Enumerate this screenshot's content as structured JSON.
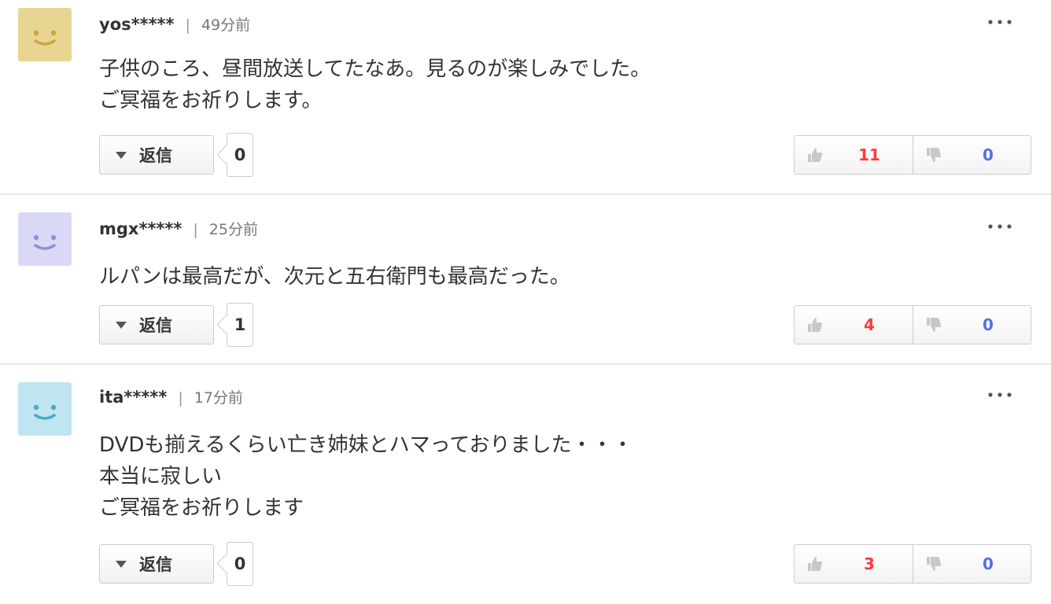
{
  "comments": [
    {
      "user": "yos*****",
      "divider": "|",
      "time": "49分前",
      "avatar_color": "#e8d592",
      "face_color": "#c9a640",
      "lines": [
        "子供のころ、昼間放送してたなあ。見るのが楽しみでした。",
        "ご冥福をお祈りします。"
      ],
      "reply_label": "返信",
      "reply_count": "0",
      "good": "11",
      "bad": "0"
    },
    {
      "user": "mgx*****",
      "divider": "|",
      "time": "25分前",
      "avatar_color": "#d9d9f5",
      "face_color": "#8f8fd6",
      "lines": [
        "ルパンは最高だが、次元と五右衛門も最高だった。"
      ],
      "reply_label": "返信",
      "reply_count": "1",
      "good": "4",
      "bad": "0"
    },
    {
      "user": "ita*****",
      "divider": "|",
      "time": "17分前",
      "avatar_color": "#bfe5f1",
      "face_color": "#4aa8cc",
      "lines": [
        "DVDも揃えるくらい亡き姉妹とハマっておりました・・・",
        "本当に寂しい",
        "ご冥福をお祈りします"
      ],
      "reply_label": "返信",
      "reply_count": "0",
      "good": "3",
      "bad": "0"
    }
  ],
  "icons": {
    "more": "more-dots-icon",
    "reply": "triangle-down-icon",
    "good": "thumbs-up-icon",
    "bad": "thumbs-down-icon"
  }
}
